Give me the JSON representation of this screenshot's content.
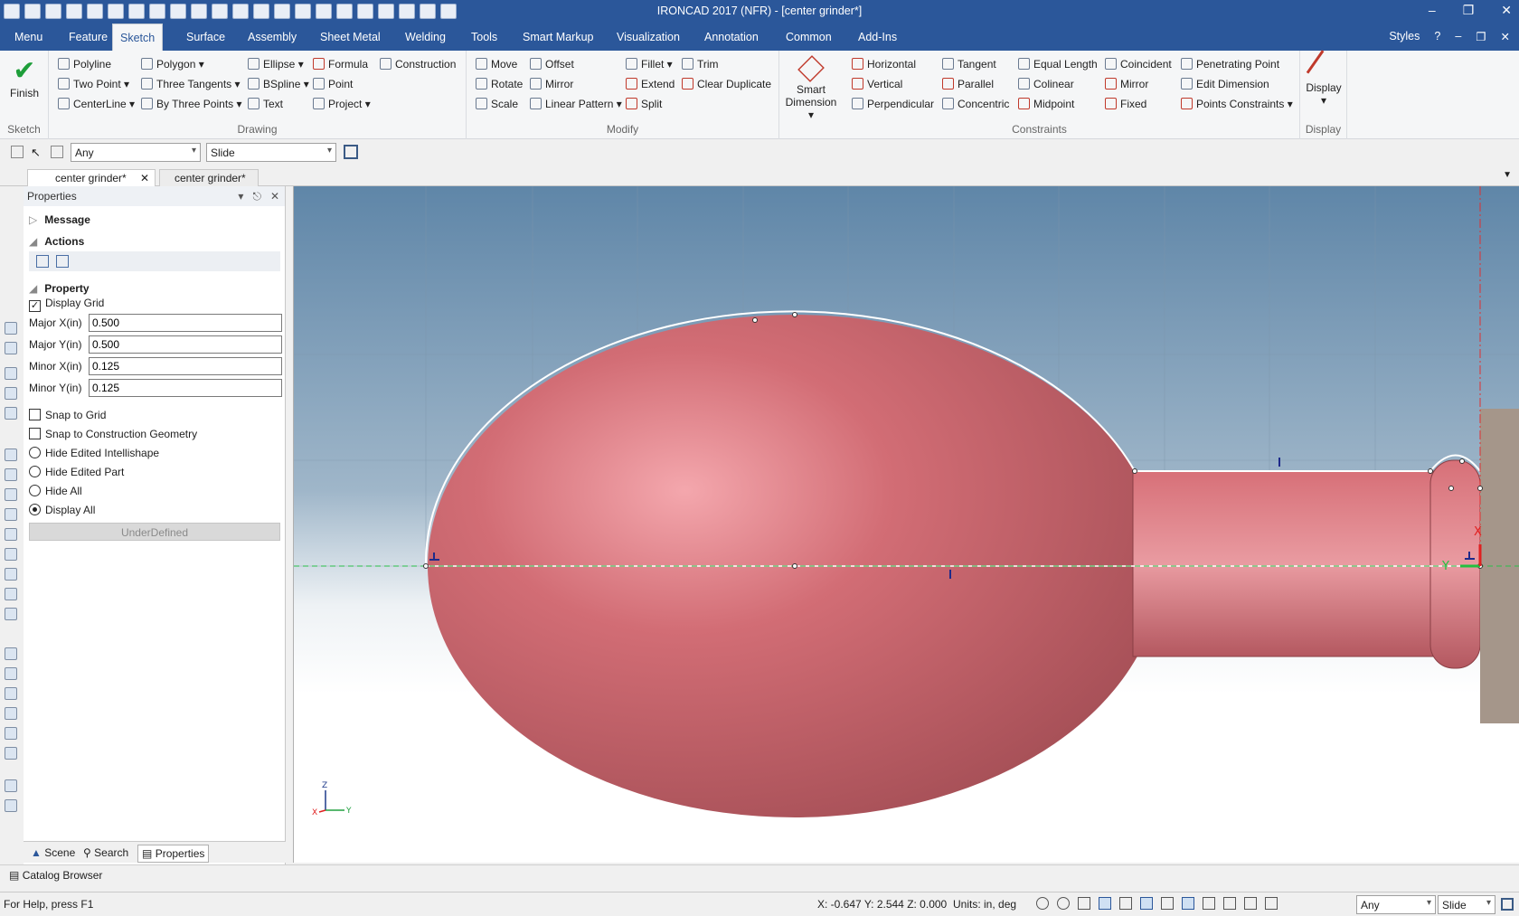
{
  "app": {
    "title": "IRONCAD 2017 (NFR) - [center grinder*]"
  },
  "menu": {
    "tabs": [
      "Menu",
      "Feature",
      "Sketch",
      "Surface",
      "Assembly",
      "Sheet Metal",
      "Welding",
      "Tools",
      "Smart Markup",
      "Visualization",
      "Annotation",
      "Common",
      "Add-Ins"
    ],
    "active": "Sketch",
    "styles_label": "Styles"
  },
  "ribbon": {
    "finish_label": "Finish",
    "sketch_group": "Sketch",
    "drawing_group": "Drawing",
    "modify_group": "Modify",
    "constraints_group": "Constraints",
    "display_group": "Display",
    "drawing": {
      "polyline": "Polyline",
      "two_point": "Two Point",
      "centerline": "CenterLine",
      "polygon": "Polygon",
      "three_tangents": "Three Tangents",
      "by_three_points": "By Three Points",
      "ellipse": "Ellipse",
      "bspline": "BSpline",
      "text": "Text",
      "formula": "Formula",
      "point": "Point",
      "project": "Project",
      "construction": "Construction"
    },
    "modify": {
      "move": "Move",
      "rotate": "Rotate",
      "scale": "Scale",
      "offset": "Offset",
      "mirror": "Mirror",
      "linear_pattern": "Linear Pattern",
      "fillet": "Fillet",
      "extend": "Extend",
      "split": "Split",
      "trim": "Trim",
      "clear_duplicate": "Clear Duplicate"
    },
    "smart_dimension_1": "Smart",
    "smart_dimension_2": "Dimension",
    "constraints": {
      "horizontal": "Horizontal",
      "vertical": "Vertical",
      "perpendicular": "Perpendicular",
      "tangent": "Tangent",
      "parallel": "Parallel",
      "concentric": "Concentric",
      "equal_length": "Equal Length",
      "colinear": "Colinear",
      "midpoint": "Midpoint",
      "coincident": "Coincident",
      "mirror": "Mirror",
      "fixed": "Fixed",
      "penetrating_point": "Penetrating Point",
      "edit_dimension": "Edit Dimension",
      "points_constraints": "Points Constraints"
    },
    "display_label": "Display"
  },
  "filter": {
    "select_value": "Any",
    "mode_value": "Slide"
  },
  "doc_tabs": [
    "center grinder*",
    "center grinder*"
  ],
  "properties": {
    "title": "Properties",
    "message": "Message",
    "actions": "Actions",
    "property": "Property",
    "display_grid": "Display Grid",
    "fields": [
      {
        "label": "Major X(in)",
        "value": "0.500"
      },
      {
        "label": "Major Y(in)",
        "value": "0.500"
      },
      {
        "label": "Minor X(in)",
        "value": "0.125"
      },
      {
        "label": "Minor Y(in)",
        "value": "0.125"
      }
    ],
    "snap_grid": "Snap to Grid",
    "snap_construction": "Snap to Construction Geometry",
    "hide_edited_intellishape": "Hide Edited Intellishape",
    "hide_edited_part": "Hide Edited Part",
    "hide_all": "Hide All",
    "display_all": "Display All",
    "status": "UnderDefined"
  },
  "bottom_tabs": {
    "scene": "Scene",
    "search": "Search",
    "properties": "Properties"
  },
  "catalog": "Catalog Browser",
  "status": {
    "help": "For Help, press F1",
    "coords": "X: -0.647 Y: 2.544 Z: 0.000",
    "units": "Units: in, deg",
    "filter": "Any",
    "mode": "Slide"
  },
  "axes": {
    "z": "Z",
    "x": "X",
    "y": "Y"
  },
  "colors": {
    "accent": "#2b579a",
    "part": "#c9606a"
  }
}
